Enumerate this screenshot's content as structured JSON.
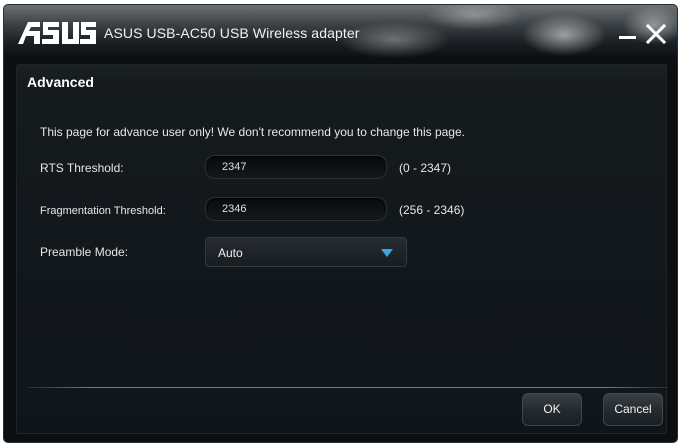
{
  "window": {
    "title": "ASUS USB-AC50 USB Wireless adapter",
    "logo_text": "ASUS"
  },
  "section": {
    "title": "Advanced",
    "notice": "This page for advance user only! We don't recommend you to change this page."
  },
  "rts": {
    "label": "RTS Threshold:",
    "value": "2347",
    "range": "(0 - 2347)"
  },
  "fragmentation": {
    "label": "Fragmentation Threshold:",
    "value": "2346",
    "range": "(256 - 2346)"
  },
  "preamble": {
    "label": "Preamble Mode:",
    "selected": "Auto"
  },
  "buttons": {
    "ok": "OK",
    "cancel": "Cancel"
  },
  "icons": {
    "minimize": "minimize-icon",
    "close": "close-icon",
    "dropdown": "triangle-down-icon"
  },
  "colors": {
    "accent": "#3aa6e0",
    "background": "#10151a"
  }
}
